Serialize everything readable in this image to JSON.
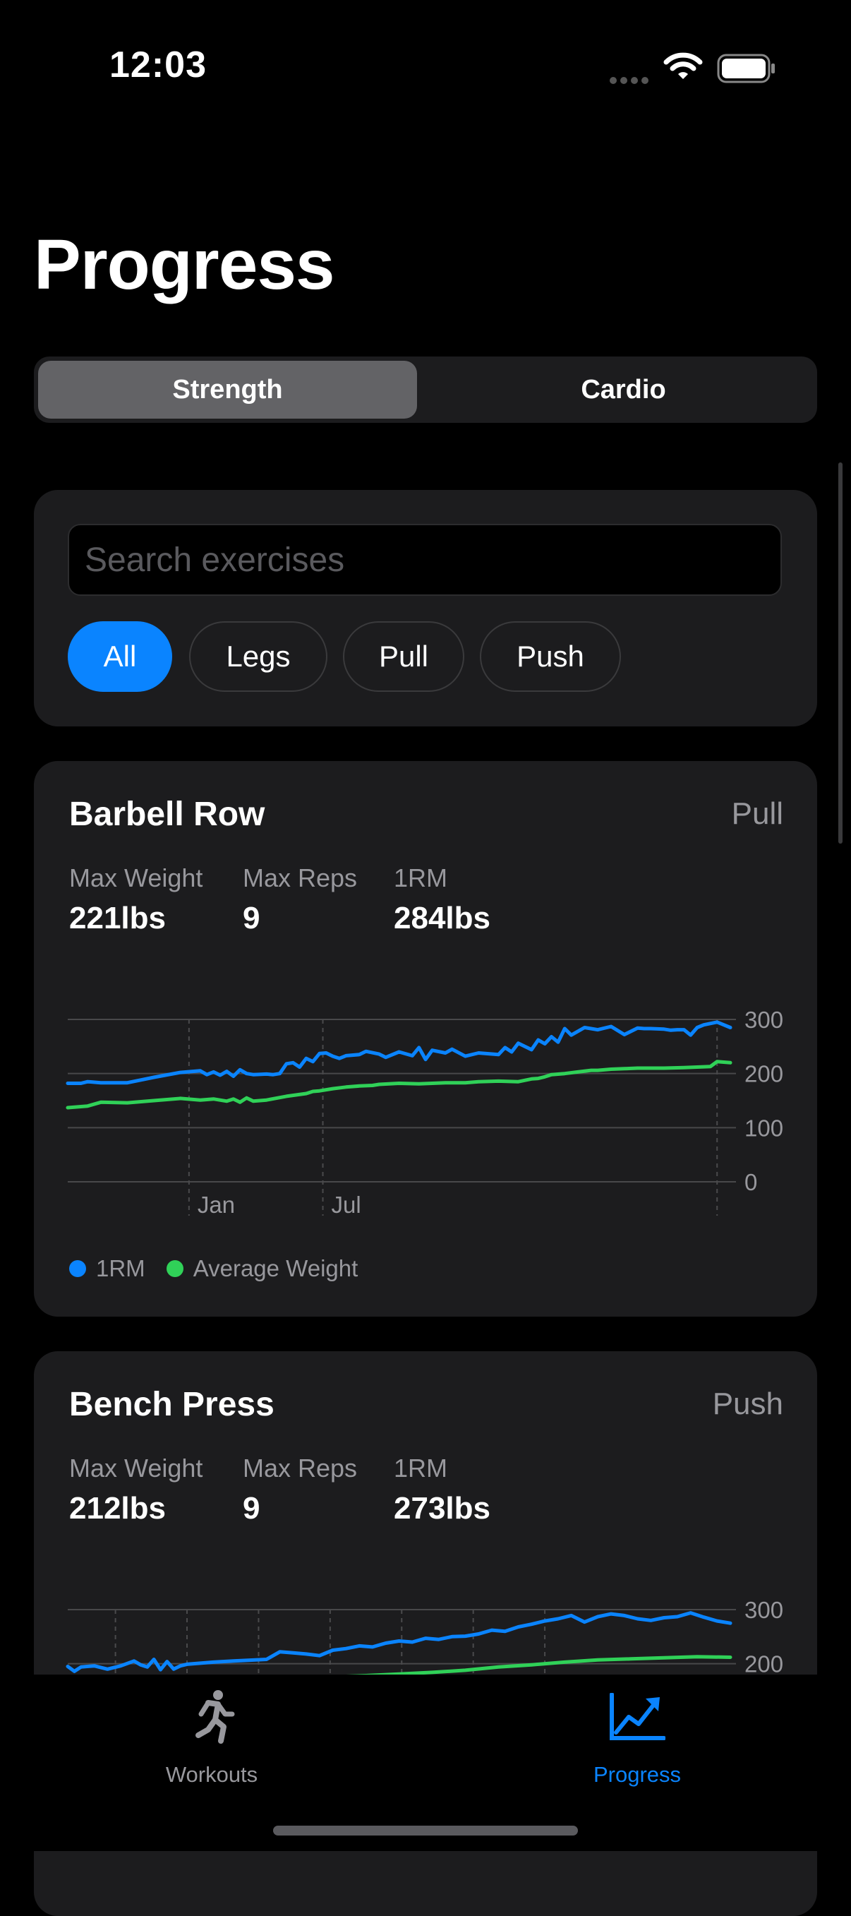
{
  "status": {
    "time": "12:03"
  },
  "title": "Progress",
  "segments": {
    "strength": "Strength",
    "cardio": "Cardio",
    "selected": "Strength"
  },
  "search": {
    "placeholder": "Search exercises",
    "value": ""
  },
  "filters": {
    "all": "All",
    "legs": "Legs",
    "pull": "Pull",
    "push": "Push",
    "selected": "All"
  },
  "colors": {
    "accent": "#0a84ff",
    "green": "#30d158",
    "card": "#1c1c1e"
  },
  "exercises": [
    {
      "name": "Barbell Row",
      "category": "Pull",
      "stats": [
        {
          "label": "Max Weight",
          "value": "221lbs"
        },
        {
          "label": "Max Reps",
          "value": "9"
        },
        {
          "label": "1RM",
          "value": "284lbs"
        }
      ]
    },
    {
      "name": "Bench Press",
      "category": "Push",
      "stats": [
        {
          "label": "Max Weight",
          "value": "212lbs"
        },
        {
          "label": "Max Reps",
          "value": "9"
        },
        {
          "label": "1RM",
          "value": "273lbs"
        }
      ]
    }
  ],
  "chart_data": [
    {
      "type": "line",
      "title": "Barbell Row",
      "y_ticks": [
        "300",
        "200",
        "100",
        "0"
      ],
      "ylim": [
        0,
        300
      ],
      "x_ticks": [
        "Jan",
        "Jul"
      ],
      "legend": [
        "1RM",
        "Average Weight"
      ],
      "series": [
        {
          "name": "1RM",
          "color": "#0a84ff",
          "x": [
            0,
            0.02,
            0.03,
            0.05,
            0.09,
            0.13,
            0.17,
            0.2,
            0.21,
            0.22,
            0.23,
            0.24,
            0.25,
            0.26,
            0.27,
            0.28,
            0.3,
            0.31,
            0.32,
            0.33,
            0.34,
            0.35,
            0.36,
            0.37,
            0.38,
            0.39,
            0.4,
            0.41,
            0.42,
            0.44,
            0.45,
            0.47,
            0.48,
            0.5,
            0.52,
            0.53,
            0.54,
            0.55,
            0.57,
            0.58,
            0.6,
            0.62,
            0.65,
            0.66,
            0.67,
            0.68,
            0.7,
            0.71,
            0.72,
            0.73,
            0.74,
            0.75,
            0.76,
            0.78,
            0.8,
            0.82,
            0.84,
            0.86,
            0.87,
            0.88,
            0.9,
            0.91,
            0.92,
            0.93,
            0.94,
            0.95,
            0.96,
            0.98,
            1.0
          ],
          "y": [
            182,
            182,
            185,
            183,
            183,
            193,
            202,
            205,
            198,
            203,
            197,
            204,
            195,
            207,
            200,
            198,
            199,
            198,
            200,
            218,
            220,
            212,
            228,
            222,
            237,
            238,
            232,
            228,
            233,
            235,
            241,
            236,
            230,
            240,
            233,
            248,
            226,
            243,
            238,
            245,
            232,
            238,
            235,
            248,
            240,
            256,
            244,
            262,
            255,
            268,
            258,
            283,
            271,
            285,
            281,
            287,
            272,
            284,
            283,
            283,
            282,
            280,
            281,
            281,
            271,
            285,
            290,
            295,
            285
          ]
        },
        {
          "name": "Average Weight",
          "color": "#30d158",
          "x": [
            0,
            0.03,
            0.05,
            0.09,
            0.13,
            0.17,
            0.2,
            0.22,
            0.24,
            0.25,
            0.26,
            0.27,
            0.28,
            0.3,
            0.33,
            0.36,
            0.37,
            0.38,
            0.4,
            0.42,
            0.44,
            0.46,
            0.47,
            0.5,
            0.53,
            0.57,
            0.58,
            0.6,
            0.62,
            0.65,
            0.68,
            0.7,
            0.71,
            0.72,
            0.73,
            0.75,
            0.77,
            0.79,
            0.8,
            0.82,
            0.84,
            0.86,
            0.88,
            0.9,
            0.93,
            0.95,
            0.97,
            0.98,
            1.0
          ],
          "y": [
            137,
            140,
            147,
            146,
            150,
            154,
            151,
            153,
            149,
            153,
            147,
            155,
            149,
            151,
            158,
            163,
            167,
            168,
            172,
            175,
            177,
            178,
            180,
            182,
            181,
            183,
            183,
            183,
            185,
            186,
            185,
            190,
            191,
            194,
            198,
            200,
            203,
            206,
            206,
            208,
            209,
            210,
            210,
            210,
            211,
            212,
            213,
            222,
            220
          ]
        }
      ]
    },
    {
      "type": "line",
      "title": "Bench Press",
      "y_ticks": [
        "300",
        "200"
      ],
      "ylim": [
        0,
        300
      ],
      "series": [
        {
          "name": "1RM",
          "color": "#0a84ff",
          "x": [
            0,
            0.01,
            0.02,
            0.04,
            0.06,
            0.08,
            0.1,
            0.11,
            0.12,
            0.13,
            0.14,
            0.15,
            0.16,
            0.17,
            0.18,
            0.2,
            0.22,
            0.25,
            0.3,
            0.32,
            0.34,
            0.36,
            0.38,
            0.4,
            0.42,
            0.44,
            0.46,
            0.48,
            0.5,
            0.52,
            0.54,
            0.56,
            0.58,
            0.6,
            0.62,
            0.64,
            0.66,
            0.68,
            0.7,
            0.72,
            0.74,
            0.76,
            0.78,
            0.8,
            0.82,
            0.84,
            0.86,
            0.88,
            0.9,
            0.92,
            0.94,
            0.96,
            0.98,
            1.0
          ],
          "y": [
            195,
            186,
            194,
            196,
            190,
            196,
            205,
            198,
            194,
            208,
            189,
            204,
            190,
            196,
            199,
            201,
            203,
            205,
            208,
            222,
            220,
            218,
            215,
            225,
            228,
            233,
            231,
            238,
            242,
            240,
            247,
            245,
            250,
            251,
            255,
            262,
            260,
            268,
            273,
            279,
            283,
            289,
            277,
            287,
            292,
            289,
            283,
            280,
            285,
            287,
            294,
            286,
            279,
            275
          ]
        },
        {
          "name": "Average Weight",
          "color": "#30d158",
          "x": [
            0.1,
            0.15,
            0.2,
            0.25,
            0.3,
            0.35,
            0.38,
            0.4,
            0.45,
            0.5,
            0.55,
            0.6,
            0.65,
            0.7,
            0.75,
            0.8,
            0.85,
            0.9,
            0.95,
            1.0
          ],
          "y": [
            150,
            150,
            148,
            152,
            155,
            172,
            174,
            176,
            178,
            181,
            184,
            188,
            194,
            198,
            203,
            207,
            209,
            211,
            213,
            212
          ]
        }
      ]
    }
  ],
  "tabs": {
    "workouts": "Workouts",
    "progress": "Progress",
    "selected": "Progress"
  }
}
